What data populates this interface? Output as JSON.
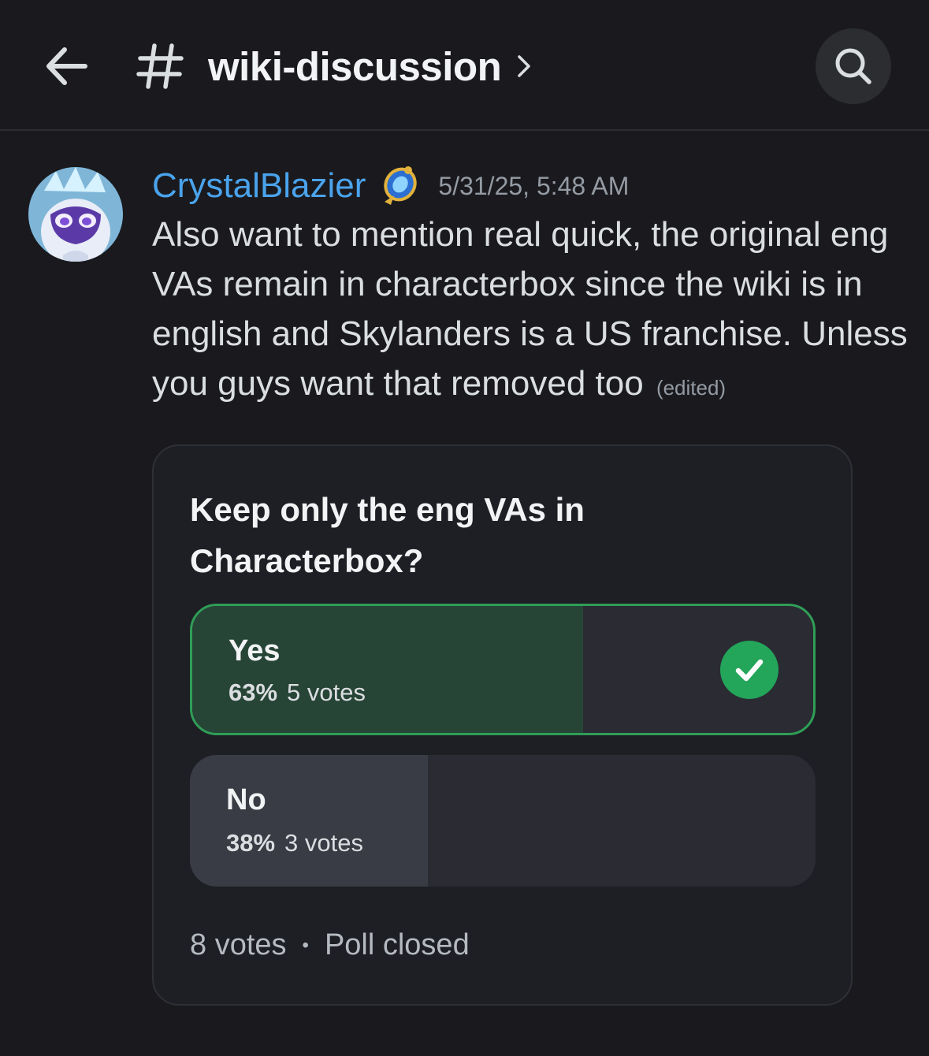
{
  "header": {
    "back_icon": "arrow-left-icon",
    "channel_icon": "hash-icon",
    "channel_name": "wiki-discussion",
    "chevron_icon": "chevron-right-icon",
    "search_icon": "search-icon"
  },
  "message": {
    "username": "CrystalBlazier",
    "username_color": "#4aa3ec",
    "badge_icon": "crystal-badge-icon",
    "timestamp": "5/31/25, 5:48 AM",
    "text": "Also want to mention real quick, the original eng VAs remain in characterbox since the wiki is in english and Skylanders is a US franchise. Unless you guys want that removed too",
    "edited_label": "(edited)"
  },
  "poll": {
    "question": "Keep only the eng VAs in Characterbox?",
    "options": [
      {
        "label": "Yes",
        "percent": "63%",
        "votes": "5 votes",
        "fraction": 0.63,
        "selected": true
      },
      {
        "label": "No",
        "percent": "38%",
        "votes": "3 votes",
        "fraction": 0.38,
        "selected": false
      }
    ],
    "total_votes": "8 votes",
    "separator": "•",
    "status": "Poll closed"
  },
  "colors": {
    "background": "#1a1a1e",
    "accent_green": "#23a55a",
    "link_blue": "#4aa3ec"
  }
}
